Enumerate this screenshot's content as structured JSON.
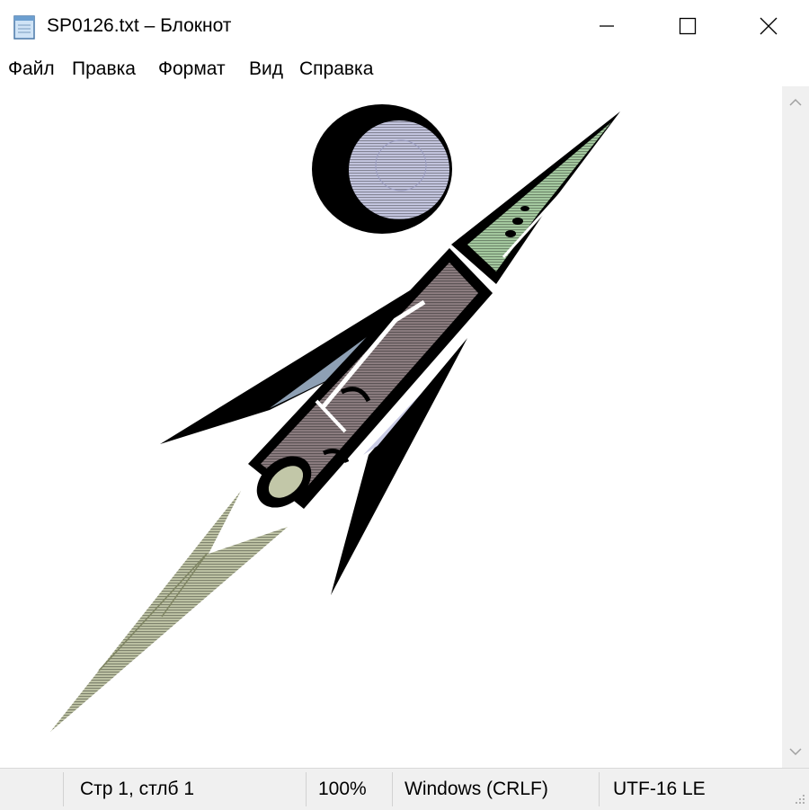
{
  "window": {
    "title": "SP0126.txt – Блокнот",
    "controls": {
      "minimize": "minimize",
      "maximize": "maximize",
      "close": "close"
    }
  },
  "menu": {
    "items": [
      "Файл",
      "Правка",
      "Формат",
      "Вид",
      "Справка"
    ]
  },
  "editor": {
    "content_description": "ASCII art of a rocket flying past the moon"
  },
  "status": {
    "position": "Стр 1, стлб 1",
    "zoom": "100%",
    "line_endings": "Windows (CRLF)",
    "encoding": "UTF-16 LE"
  },
  "colors": {
    "nose": "#a9cfa4",
    "body": "#8e7f82",
    "fin_blue": "#8ea0b4",
    "moon": "#c9cbe5",
    "exhaust": "#c2c7a8"
  }
}
